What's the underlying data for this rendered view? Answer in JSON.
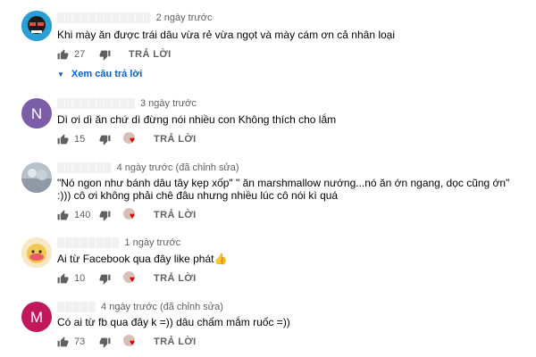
{
  "comments": [
    {
      "time": "2 ngày trước",
      "text": [
        "Khi mày ăn được trái dâu vừa rẻ vừa ngọt và mày cám ơn cả nhân loại"
      ],
      "likes": "27",
      "reply_label": "TRẢ LỜI",
      "view_replies": "Xem câu trả lời",
      "avatar": {
        "type": "image",
        "colors": [
          "#2a9fd6",
          "#e84c3d"
        ]
      }
    },
    {
      "time": "3 ngày trước",
      "text": [
        "Dì ơi dì ăn chứ dì đừng nói nhiều con Không thích cho lắm"
      ],
      "likes": "15",
      "reply_label": "TRẢ LỜI",
      "avatar": {
        "type": "letter",
        "letter": "N",
        "color": "#7b5ea7"
      }
    },
    {
      "time": "4 ngày trước (đã chỉnh sửa)",
      "text": [
        "\"Nó ngon như bánh dâu tây kẹp xốp\" \" ăn marshmallow nướng...nó ăn ớn ngang, dọc cũng ớn\"",
        ":))) cô ơi không phải chê đâu nhưng nhiều lúc cô nói kì quá"
      ],
      "likes": "140",
      "reply_label": "TRẢ LỜI",
      "avatar": {
        "type": "image",
        "colors": [
          "#9aa7b3",
          "#dfe6ec"
        ]
      }
    },
    {
      "time": "1 ngày trước",
      "text": [
        "Ai từ Facebook qua đây like phát👍"
      ],
      "likes": "10",
      "reply_label": "TRẢ LỜI",
      "avatar": {
        "type": "image",
        "colors": [
          "#f2c94c",
          "#e85a6a"
        ]
      }
    },
    {
      "time": "4 ngày trước (đã chỉnh sửa)",
      "text": [
        "Có ai từ fb qua đây k =)) dâu chấm mắm ruốc  =))"
      ],
      "likes": "73",
      "reply_label": "TRẢ LỜI",
      "avatar": {
        "type": "letter",
        "letter": "M",
        "color": "#c2185b"
      }
    }
  ],
  "colors": {
    "link": "#065fd4",
    "meta": "#606060",
    "text": "#030303",
    "heart": "#e00000"
  }
}
